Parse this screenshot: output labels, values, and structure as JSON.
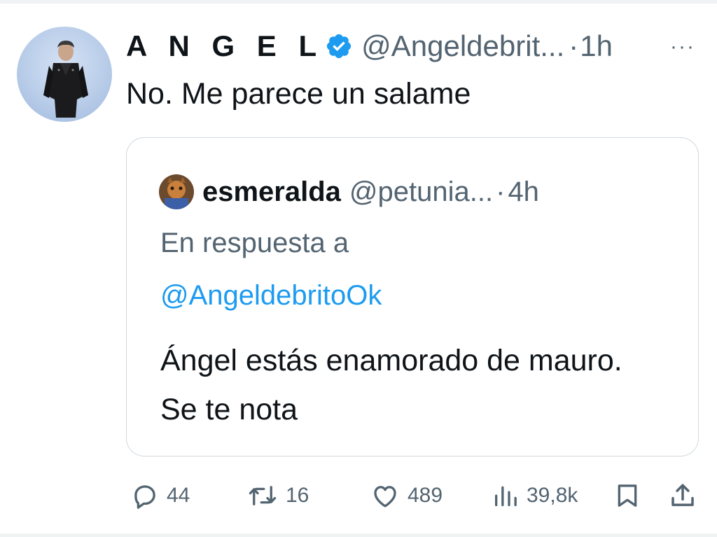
{
  "tweet": {
    "author_name": "A N G E L",
    "author_handle": "@Angeldebrit...",
    "separator": "·",
    "time": "1h",
    "more_label": "···",
    "text": "No. Me parece un salame"
  },
  "quote": {
    "author_name": "esmeralda",
    "author_handle": "@petunia...",
    "separator": "·",
    "time": "4h",
    "reply_prefix": "En respuesta a",
    "reply_mention": "@AngeldebritoOk",
    "text": "Ángel estás enamorado de mauro. Se te nota"
  },
  "actions": {
    "replies": "44",
    "retweets": "16",
    "likes": "489",
    "views": "39,8k"
  },
  "colors": {
    "text_primary": "#0f1419",
    "text_secondary": "#536471",
    "link": "#1d9bf0",
    "verified": "#1d9bf0",
    "border": "#cfd9de"
  },
  "icons": [
    "verified-badge-icon",
    "more-icon",
    "reply-icon",
    "retweet-icon",
    "like-icon",
    "views-icon",
    "bookmark-icon",
    "share-icon"
  ]
}
